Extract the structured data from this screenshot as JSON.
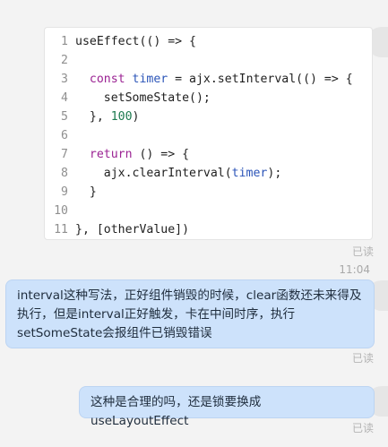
{
  "code_block": {
    "lines": [
      {
        "num": "1",
        "parts": [
          {
            "t": "useEffect(() => {",
            "c": "fn"
          }
        ]
      },
      {
        "num": "2",
        "parts": []
      },
      {
        "num": "3",
        "parts": [
          {
            "t": "  ",
            "c": "fn"
          },
          {
            "t": "const",
            "c": "kw"
          },
          {
            "t": " timer",
            "c": "var"
          },
          {
            "t": " = ajx.setInterval(() => {",
            "c": "fn"
          }
        ]
      },
      {
        "num": "4",
        "parts": [
          {
            "t": "    setSomeState();",
            "c": "fn"
          }
        ]
      },
      {
        "num": "5",
        "parts": [
          {
            "t": "  }, ",
            "c": "fn"
          },
          {
            "t": "100",
            "c": "num"
          },
          {
            "t": ")",
            "c": "fn"
          }
        ]
      },
      {
        "num": "6",
        "parts": []
      },
      {
        "num": "7",
        "parts": [
          {
            "t": "  ",
            "c": "fn"
          },
          {
            "t": "return",
            "c": "kw"
          },
          {
            "t": " () => {",
            "c": "fn"
          }
        ]
      },
      {
        "num": "8",
        "parts": [
          {
            "t": "    ajx.clearInterval(",
            "c": "fn"
          },
          {
            "t": "timer",
            "c": "var"
          },
          {
            "t": ");",
            "c": "fn"
          }
        ]
      },
      {
        "num": "9",
        "parts": [
          {
            "t": "  }",
            "c": "fn"
          }
        ]
      },
      {
        "num": "10",
        "parts": []
      },
      {
        "num": "11",
        "parts": [
          {
            "t": "}, [otherValue])",
            "c": "fn"
          }
        ]
      }
    ],
    "read_status": "已读"
  },
  "timestamp": "11:04",
  "messages": [
    {
      "lines": [
        "interval这种写法，正好组件销毁的时候，clear函数还未来得及",
        "执行，但是interval正好触发，卡在中间时序，执行",
        "setSomeState会报组件已销毁错误"
      ],
      "read_status": "已读"
    },
    {
      "lines": [
        "这种是合理的吗，还是锁要换成 useLayoutEffect"
      ],
      "read_status": "已读"
    }
  ]
}
